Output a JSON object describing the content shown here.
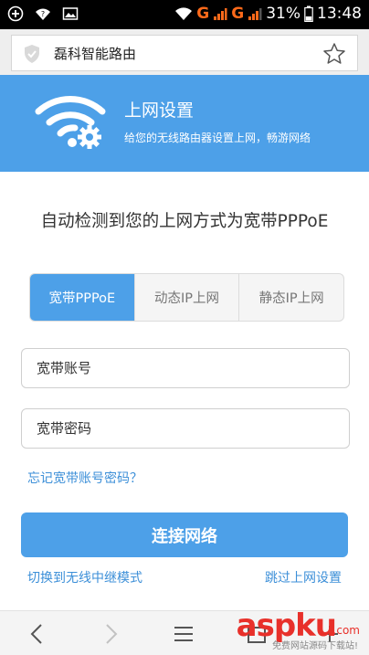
{
  "status_bar": {
    "left_icons": [
      "add-circle-icon",
      "wifi-question-icon",
      "image-icon"
    ],
    "network_g1": "G",
    "network_g2": "G",
    "battery": "31%",
    "time": "13:48"
  },
  "browser": {
    "page_title": "磊科智能路由"
  },
  "header": {
    "title": "上网设置",
    "subtitle": "给您的无线路由器设置上网，畅游网络"
  },
  "detect_text": "自动检测到您的上网方式为宽带PPPoE",
  "tabs": [
    {
      "label": "宽带PPPoE",
      "active": true
    },
    {
      "label": "动态IP上网",
      "active": false
    },
    {
      "label": "静态IP上网",
      "active": false
    }
  ],
  "form": {
    "account_placeholder": "宽带账号",
    "password_placeholder": "宽带密码",
    "forgot_link": "忘记宽带账号密码？",
    "connect_button": "连接网络",
    "repeater_link": "切换到无线中继模式",
    "skip_link": "跳过上网设置"
  },
  "watermark": {
    "brand": "aspku",
    "suffix": ".com",
    "tagline": "免费网站源码下载站!"
  },
  "colors": {
    "accent": "#4da0e8",
    "link": "#3c8fd8",
    "status_g": "#ff6a1a"
  }
}
